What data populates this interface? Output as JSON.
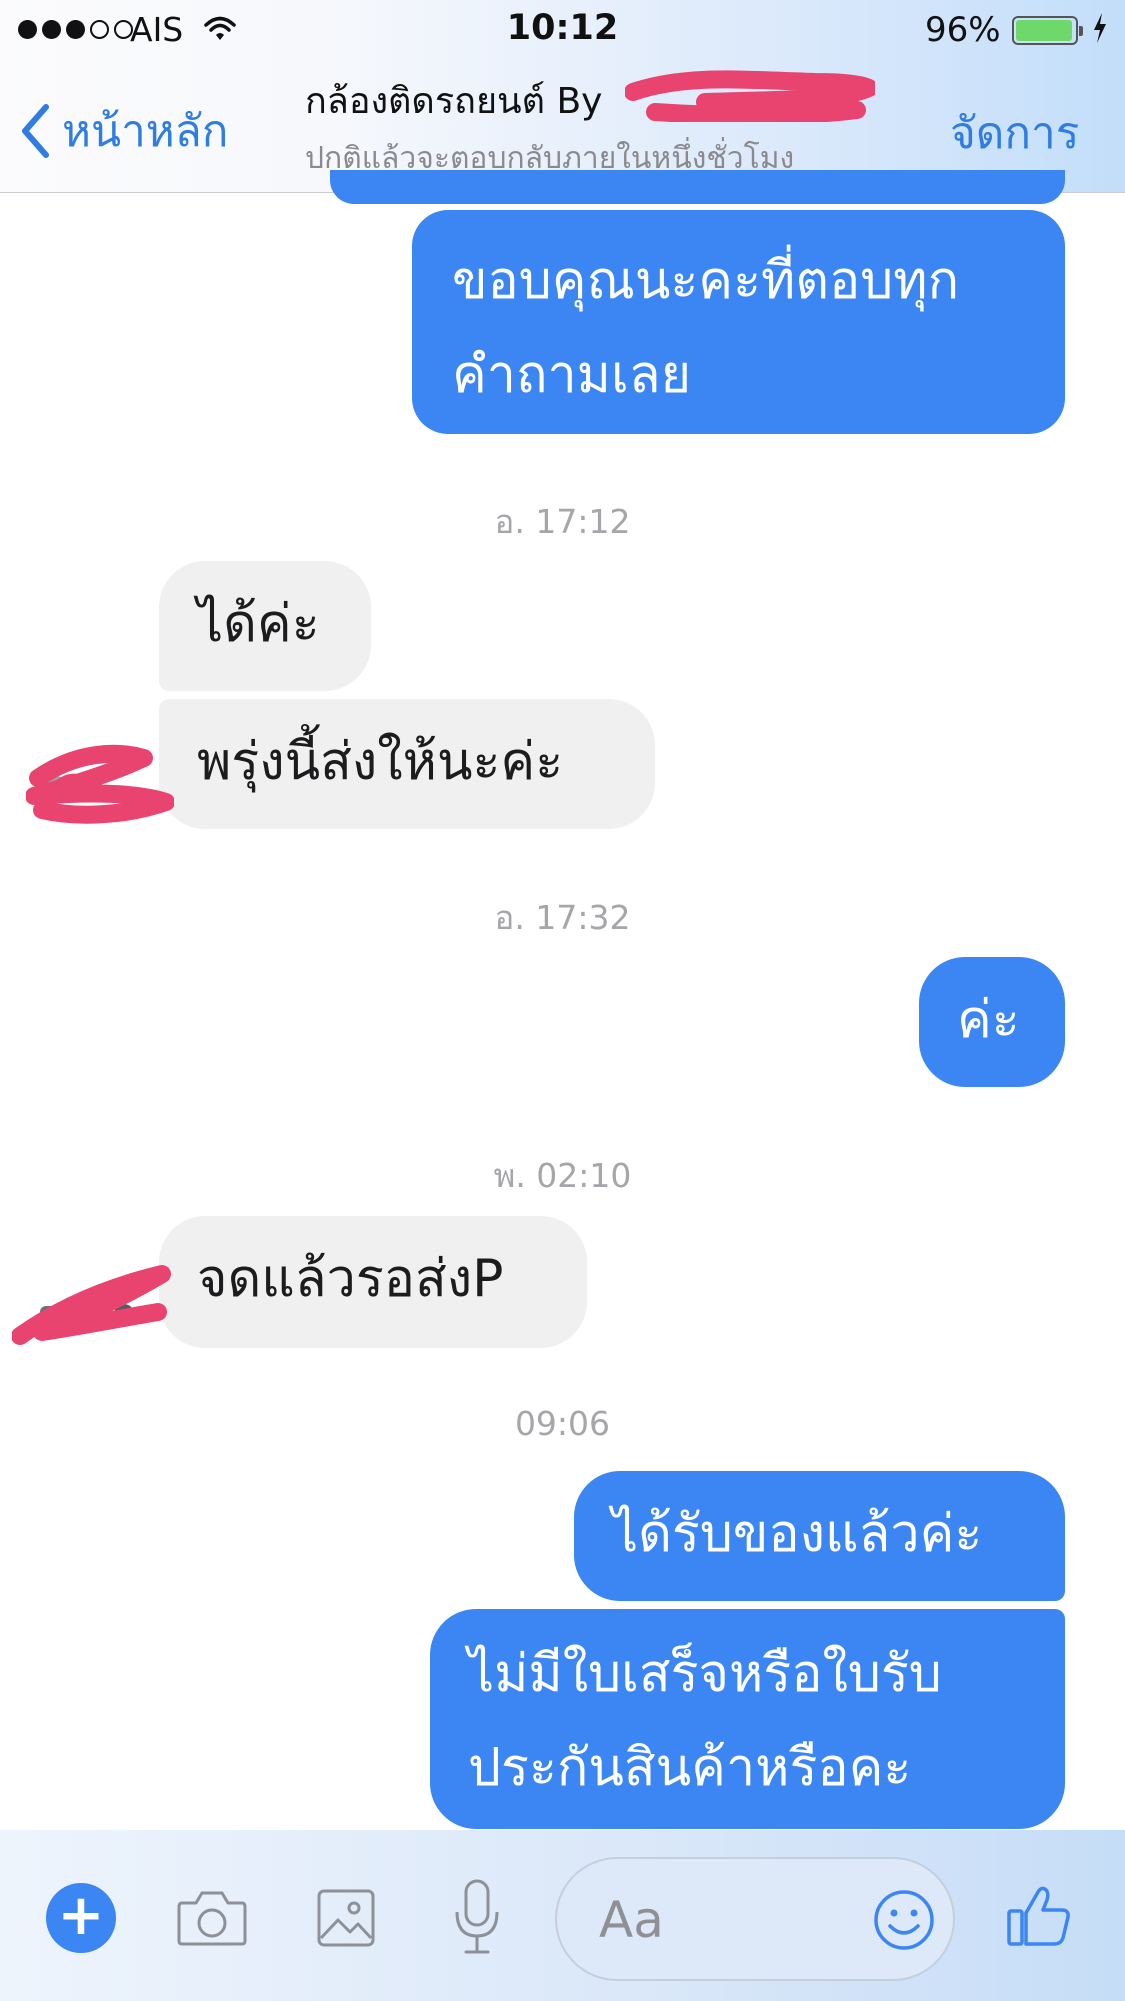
{
  "status_bar": {
    "carrier": "AIS",
    "time": "10:12",
    "battery_percent": "96%",
    "battery_level": 0.96
  },
  "header": {
    "back_label": "หน้าหลัก",
    "title": "กล้องติดรถยนต์ By",
    "subtitle": "ปกติแล้วจะตอบกลับภายในหนึ่งชั่วโมง",
    "action_label": "จัดการ"
  },
  "messages": [
    {
      "type": "outgoing",
      "lines": [
        "ขอบคุณนะคะที่ตอบทุก",
        "คำถามเลย"
      ]
    },
    {
      "type": "timestamp",
      "text": "อ. 17:12"
    },
    {
      "type": "incoming",
      "lines": [
        "ได้ค่ะ"
      ]
    },
    {
      "type": "incoming",
      "lines": [
        "พรุ่งนี้ส่งให้นะค่ะ"
      ]
    },
    {
      "type": "timestamp",
      "text": "อ. 17:32"
    },
    {
      "type": "outgoing",
      "lines": [
        "ค่ะ"
      ]
    },
    {
      "type": "timestamp",
      "text": "พ. 02:10"
    },
    {
      "type": "incoming",
      "lines": [
        "จดแล้วรอส่งP"
      ]
    },
    {
      "type": "timestamp",
      "text": "09:06"
    },
    {
      "type": "outgoing",
      "lines": [
        "ได้รับของแล้วค่ะ"
      ]
    },
    {
      "type": "outgoing",
      "lines": [
        "ไม่มีใบเสร็จหรือใบรับ",
        "ประกันสินค้าหรือคะ"
      ]
    }
  ],
  "composer": {
    "placeholder": "Aa",
    "icons": [
      "plus-icon",
      "camera-icon",
      "photo-icon",
      "microphone-icon",
      "emoji-icon",
      "thumbs-up-icon"
    ]
  },
  "colors": {
    "accent": "#2f7de2",
    "outgoing_bubble": "#3b86f2",
    "incoming_bubble": "#f0f0f0",
    "redaction": "#e9446f"
  }
}
